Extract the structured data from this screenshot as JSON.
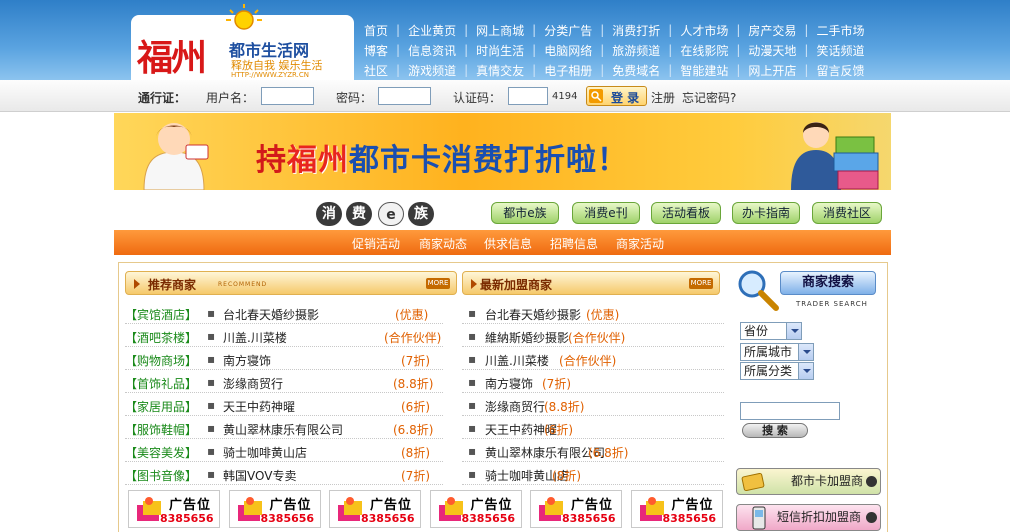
{
  "logo": {
    "name_big": "福州",
    "name_mid": "都市生活网",
    "slogan": "释放自我 娱乐生活",
    "url": "HTTP://WWW.ZYZR.CN"
  },
  "nav": {
    "rows": [
      [
        "首页",
        "企业黄页",
        "网上商城",
        "分类广告",
        "消费打折",
        "人才市场",
        "房产交易",
        "二手市场"
      ],
      [
        "博客",
        "信息资讯",
        "时尚生活",
        "电脑网络",
        "旅游频道",
        "在线影院",
        "动漫天地",
        "笑话频道"
      ],
      [
        "社区",
        "游戏频道",
        "真情交友",
        "电子相册",
        "免费域名",
        "智能建站",
        "网上开店",
        "留言反馈"
      ]
    ]
  },
  "login": {
    "pass_label": "通行证：",
    "user_label": "用户名：",
    "pwd_label": "密码：",
    "code_label": "认证码：",
    "code_value": "4194",
    "login_button": "登 录",
    "register": "注册",
    "forgot": "忘记密码?"
  },
  "banner": {
    "pre": "持",
    "city": "福州",
    "post": "都市卡消费打折啦！"
  },
  "ezu": {
    "chars": [
      "消",
      "费",
      "e",
      "族"
    ]
  },
  "tabs": [
    "都市e族",
    "消费e刊",
    "活动看板",
    "办卡指南",
    "消费社区"
  ],
  "orange_links": [
    "促销活动",
    "商家动态",
    "供求信息",
    "招聘信息",
    "商家活动"
  ],
  "left_col": {
    "title": "推荐商家",
    "en": "RECOMMEND",
    "more": "MORE",
    "rows": [
      {
        "cat": "【宾馆酒店】",
        "name": "台北春天婚纱摄影",
        "tag": "(优惠)"
      },
      {
        "cat": "【酒吧茶楼】",
        "name": "川盖.川菜楼",
        "tag": "(合作伙伴)"
      },
      {
        "cat": "【购物商场】",
        "name": "南方寝饰",
        "tag": "(7折)"
      },
      {
        "cat": "【首饰礼品】",
        "name": "澎缘商贸行",
        "tag": "(8.8折)"
      },
      {
        "cat": "【家居用品】",
        "name": "天王中药神曜",
        "tag": "(6折)"
      },
      {
        "cat": "【服饰鞋帽】",
        "name": "黄山翠林康乐有限公司",
        "tag": "(6.8折)"
      },
      {
        "cat": "【美容美发】",
        "name": "骑士咖啡黄山店",
        "tag": "(8折)"
      },
      {
        "cat": "【图书音像】",
        "name": "韩国VOV专卖",
        "tag": "(7折)"
      }
    ]
  },
  "right_col": {
    "title": "最新加盟商家",
    "more": "MORE",
    "rows": [
      {
        "name": "台北春天婚纱摄影",
        "tag": "(优惠)"
      },
      {
        "name": "維納斯婚纱摄影",
        "tag": "(合作伙伴)"
      },
      {
        "name": "川盖.川菜楼",
        "tag": "(合作伙伴)"
      },
      {
        "name": "南方寝饰",
        "tag": "(7折)"
      },
      {
        "name": "澎缘商贸行",
        "tag": "(8.8折)"
      },
      {
        "name": "天王中药神曜",
        "tag": "(6折)"
      },
      {
        "name": "黄山翠林康乐有限公司",
        "tag": "(6.8折)"
      },
      {
        "name": "骑士咖啡黄山店",
        "tag": "(8折)"
      }
    ]
  },
  "search": {
    "title": "商家搜索",
    "en": "TRADER SEARCH",
    "selects": [
      "省份",
      "所属城市",
      "所属分类"
    ],
    "button": "搜 索",
    "card_btn": "都市卡加盟商",
    "sms_btn": "短信折扣加盟商"
  },
  "ads": [
    {
      "t1": "广告位",
      "t2": "8385656"
    },
    {
      "t1": "广告位",
      "t2": "8385656"
    },
    {
      "t1": "广告位",
      "t2": "8385656"
    },
    {
      "t1": "广告位",
      "t2": "8385656"
    },
    {
      "t1": "广告位",
      "t2": "8385656"
    },
    {
      "t1": "广告位",
      "t2": "8385656"
    }
  ],
  "colors": {
    "header_blue": "#2f7fc8",
    "orange": "#ef6a10",
    "brand_red": "#d81818",
    "green_cat": "#1a8a1a",
    "tag_orange": "#e06000"
  }
}
